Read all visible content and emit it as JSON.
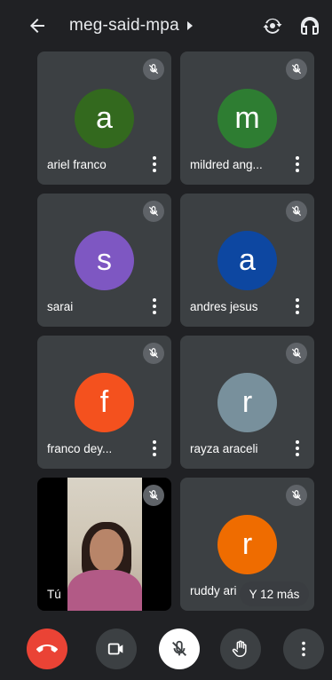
{
  "header": {
    "title": "meg-said-mpa",
    "icons": [
      "back-arrow-icon",
      "caret-right-icon",
      "switch-camera-icon",
      "headphones-icon"
    ]
  },
  "participants": [
    {
      "name": "ariel franco",
      "initial": "a",
      "color": "#33691e",
      "muted": true
    },
    {
      "name": "mildred ang...",
      "initial": "m",
      "color": "#2e7d32",
      "muted": true
    },
    {
      "name": "sarai",
      "initial": "s",
      "color": "#7e57c2",
      "muted": true
    },
    {
      "name": "andres jesus",
      "initial": "a",
      "color": "#0d47a1",
      "muted": true
    },
    {
      "name": "franco dey...",
      "initial": "f",
      "color": "#f4511e",
      "muted": true
    },
    {
      "name": "rayza araceli",
      "initial": "r",
      "color": "#78909c",
      "muted": true
    },
    {
      "name": "Tú",
      "initial": "",
      "color": "#000000",
      "muted": true,
      "video": true
    },
    {
      "name": "ruddy ari",
      "initial": "r",
      "color": "#ef6c00",
      "muted": true
    }
  ],
  "more_label": "Y 12 más",
  "controls": {
    "end_call_color": "#ea4335",
    "icons": [
      "end-call-icon",
      "camera-icon",
      "mic-off-icon",
      "raise-hand-icon",
      "more-options-icon"
    ]
  }
}
